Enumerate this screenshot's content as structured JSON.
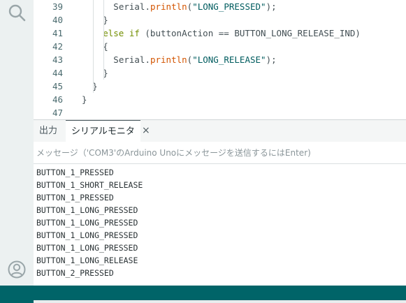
{
  "editor": {
    "lines": [
      {
        "no": "39",
        "indent": 6,
        "parts": [
          {
            "t": "Serial.",
            "c": "plain"
          },
          {
            "t": "println",
            "c": "fn"
          },
          {
            "t": "(",
            "c": "plain"
          },
          {
            "t": "\"LONG_PRESSED\"",
            "c": "str"
          },
          {
            "t": ");",
            "c": "plain"
          }
        ]
      },
      {
        "no": "40",
        "indent": 4,
        "parts": [
          {
            "t": "}",
            "c": "plain"
          }
        ]
      },
      {
        "no": "41",
        "indent": 4,
        "parts": [
          {
            "t": "else if",
            "c": "kw"
          },
          {
            "t": " (buttonAction == BUTTON_LONG_RELEASE_IND)",
            "c": "plain"
          }
        ]
      },
      {
        "no": "42",
        "indent": 4,
        "parts": [
          {
            "t": "{",
            "c": "plain"
          }
        ]
      },
      {
        "no": "43",
        "indent": 6,
        "parts": [
          {
            "t": "Serial.",
            "c": "plain"
          },
          {
            "t": "println",
            "c": "fn"
          },
          {
            "t": "(",
            "c": "plain"
          },
          {
            "t": "\"LONG_RELEASE\"",
            "c": "str"
          },
          {
            "t": ");",
            "c": "plain"
          }
        ]
      },
      {
        "no": "44",
        "indent": 4,
        "parts": [
          {
            "t": "}",
            "c": "plain"
          }
        ]
      },
      {
        "no": "45",
        "indent": 2,
        "parts": [
          {
            "t": "}",
            "c": "plain"
          }
        ]
      },
      {
        "no": "46",
        "indent": 0,
        "parts": [
          {
            "t": "}",
            "c": "plain"
          }
        ]
      },
      {
        "no": "47",
        "indent": 0,
        "parts": []
      }
    ]
  },
  "panel": {
    "tab_output": "出力",
    "tab_serial": "シリアルモニタ",
    "tab_close": "×",
    "message_placeholder": "メッセージ（'COM3'のArduino Unoにメッセージを送信するにはEnter)",
    "serial_lines": [
      "BUTTON_1_PRESSED",
      "BUTTON_1_SHORT_RELEASE",
      "BUTTON_1_PRESSED",
      "BUTTON_1_LONG_PRESSED",
      "BUTTON_1_LONG_PRESSED",
      "BUTTON_1_LONG_PRESSED",
      "BUTTON_1_LONG_PRESSED",
      "BUTTON_1_LONG_RELEASE",
      "BUTTON_2_PRESSED"
    ]
  },
  "icons": {
    "search": "search-icon",
    "account": "account-icon"
  },
  "colors": {
    "status_bar": "#006468",
    "activity_bar": "#ecf1f1",
    "string": "#005c5f",
    "function": "#d35400",
    "keyword": "#728e00"
  }
}
